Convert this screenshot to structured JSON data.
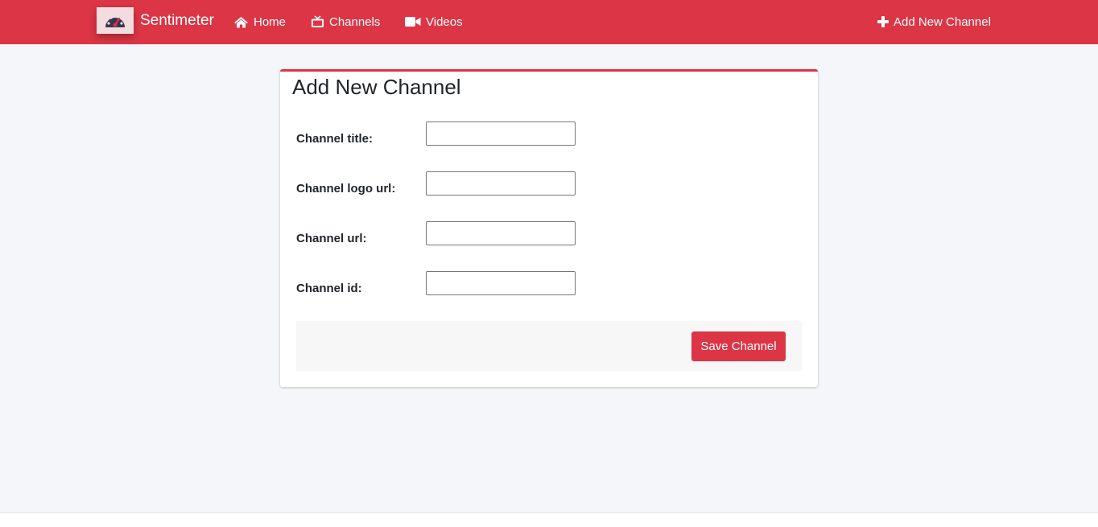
{
  "navbar": {
    "brand_name": "Sentimeter",
    "brand_icon": "speedometer-icon",
    "links": [
      {
        "label": "Home",
        "icon": "home-icon"
      },
      {
        "label": "Channels",
        "icon": "tv-icon"
      },
      {
        "label": "Videos",
        "icon": "video-camera-icon"
      }
    ],
    "action": {
      "label": "Add New Channel",
      "icon": "plus-icon"
    }
  },
  "form": {
    "title": "Add New Channel",
    "fields": [
      {
        "label": "Channel title:",
        "value": "",
        "placeholder": ""
      },
      {
        "label": "Channel logo url:",
        "value": "",
        "placeholder": ""
      },
      {
        "label": "Channel url:",
        "value": "",
        "placeholder": ""
      },
      {
        "label": "Channel id:",
        "value": "",
        "placeholder": ""
      }
    ],
    "save_label": "Save Channel"
  },
  "colors": {
    "accent": "#dc3545",
    "background": "#f4f6f9"
  }
}
